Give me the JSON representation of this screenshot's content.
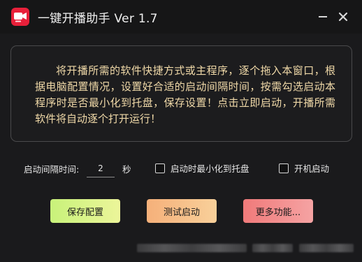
{
  "window": {
    "title": "一键开播助手 Ver 1.7",
    "icon": "video-camera-icon",
    "accent_color": "#e8203a"
  },
  "info": {
    "text": "将开播所需的软件快捷方式或主程序，逐个拖入本窗口，根据电脑配置情况，设置好合适的启动间隔时间，按需勾选启动本程序时是否最小化到托盘，保存设置！点击立即启动，开播所需软件将自动逐个打开运行！",
    "text_color": "#f0d9a8"
  },
  "settings": {
    "interval_label": "启动间隔时间:",
    "interval_value": "2",
    "interval_unit": "秒",
    "minimize_label": "启动时最小化到托盘",
    "minimize_checked": false,
    "autostart_label": "开机启动",
    "autostart_checked": false
  },
  "buttons": {
    "save": "保存配置",
    "test": "测试启动",
    "more": "更多功能..."
  }
}
